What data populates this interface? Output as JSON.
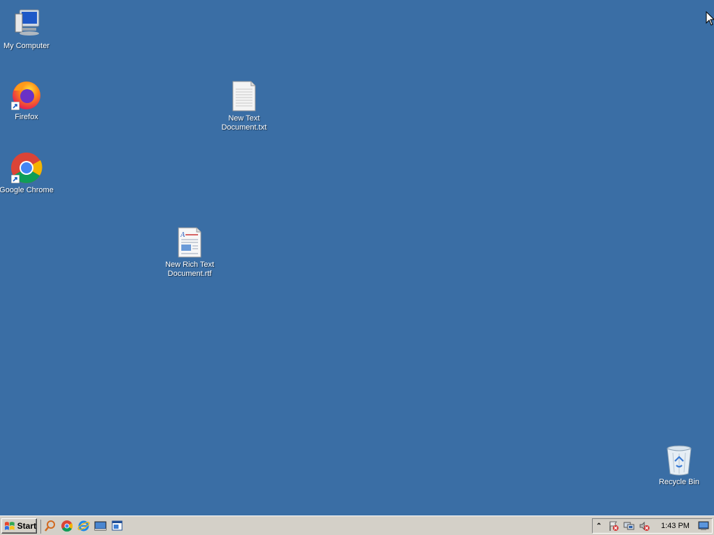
{
  "desktop": {
    "background_color": "#3a6ea5",
    "icons": [
      {
        "label": "My Computer",
        "icon": "computer-icon"
      },
      {
        "label": "Firefox",
        "icon": "firefox-icon"
      },
      {
        "label": "Google Chrome",
        "icon": "chrome-icon"
      },
      {
        "label": "New Text Document.txt",
        "icon": "text-file-icon"
      },
      {
        "label": "New Rich Text Document.rtf",
        "icon": "rtf-file-icon"
      },
      {
        "label": "Recycle Bin",
        "icon": "recycle-bin-icon"
      }
    ]
  },
  "taskbar": {
    "start_label": "Start",
    "quicklaunch": [
      "search-icon",
      "chrome-icon",
      "internet-explorer-icon",
      "show-desktop-icon",
      "window-switcher-icon"
    ],
    "tray": {
      "expand_label": "⌃",
      "icons": [
        "action-center-icon",
        "network-icon",
        "volume-muted-icon"
      ],
      "clock": "1:43 PM"
    }
  }
}
